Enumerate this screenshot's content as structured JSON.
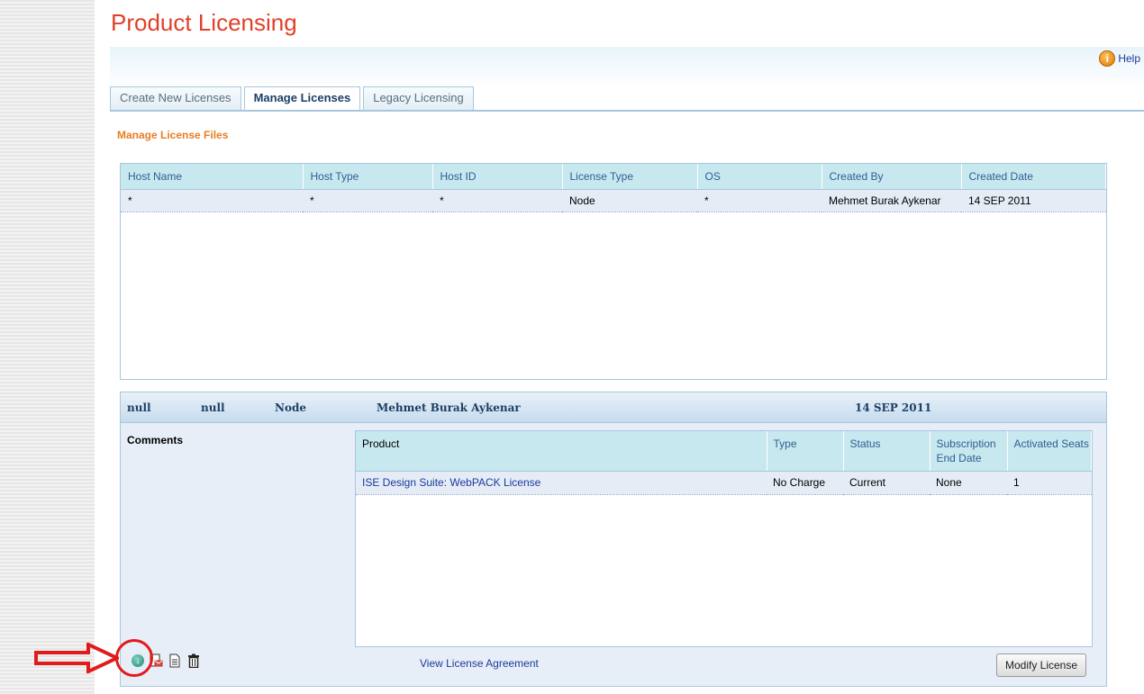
{
  "page": {
    "title": "Product Licensing",
    "help_label": "Help"
  },
  "tabs": [
    {
      "label": "Create New Licenses",
      "active": false
    },
    {
      "label": "Manage Licenses",
      "active": true
    },
    {
      "label": "Legacy Licensing",
      "active": false
    }
  ],
  "section_title": "Manage License Files",
  "license_files": {
    "columns": [
      "Host Name",
      "Host Type",
      "Host ID",
      "License Type",
      "OS",
      "Created By",
      "Created Date"
    ],
    "rows": [
      [
        "*",
        "*",
        "*",
        "Node",
        "*",
        "Mehmet Burak Aykenar",
        "14 SEP 2011"
      ]
    ]
  },
  "detail": {
    "host_name": "null",
    "host_type": "null",
    "license_type": "Node",
    "created_by": "Mehmet Burak Aykenar",
    "created_date": "14 SEP 2011",
    "comments_label": "Comments",
    "products": {
      "columns": [
        "Product",
        "Type",
        "Status",
        "Subscription End Date",
        "Activated Seats"
      ],
      "rows": [
        [
          "ISE Design Suite: WebPACK License",
          "No Charge",
          "Current",
          "None",
          "1"
        ]
      ]
    },
    "view_agreement_label": "View License Agreement",
    "modify_button_label": "Modify License"
  },
  "icons": [
    "download-icon",
    "email-icon",
    "document-icon",
    "trash-icon",
    "help-icon",
    "arrow-annotation"
  ],
  "colors": {
    "title": "#e0402a",
    "section": "#e67e22",
    "header_bg": "#c7e8ef",
    "row_bg": "#e5ecf6",
    "annotation": "#e01b1b"
  }
}
